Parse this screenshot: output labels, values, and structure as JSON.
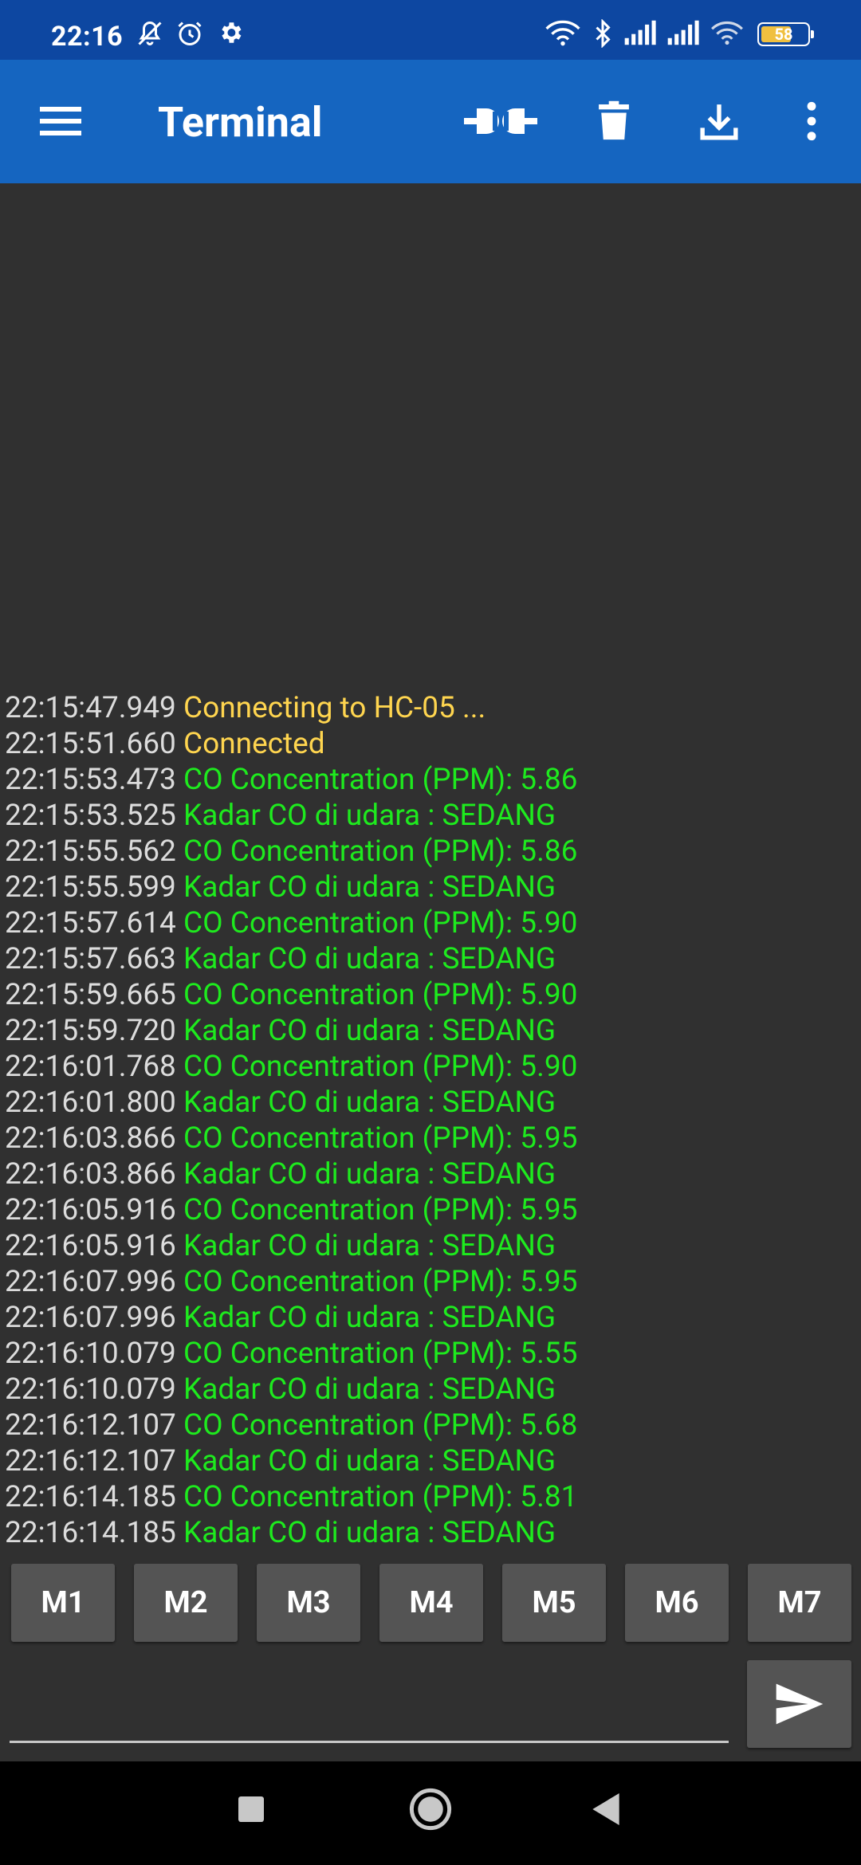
{
  "status_bar": {
    "time": "22:16",
    "icons": [
      "bell-off-icon",
      "alarm-icon",
      "gear-icon",
      "wifi-link-icon",
      "bluetooth-icon",
      "signal-icon",
      "signal-icon",
      "wifi-icon",
      "battery-icon"
    ],
    "battery_level": "58"
  },
  "app_bar": {
    "title": "Terminal",
    "actions": [
      "connect-icon",
      "delete-icon",
      "download-icon",
      "more-vert-icon"
    ]
  },
  "log": [
    {
      "time": "22:15:47.949",
      "text": "Connecting to HC-05 ...",
      "kind": "status"
    },
    {
      "time": "22:15:51.660",
      "text": "Connected",
      "kind": "status"
    },
    {
      "time": "22:15:53.473",
      "text": "CO Concentration (PPM): 5.86",
      "kind": "data"
    },
    {
      "time": "22:15:53.525",
      "text": "Kadar CO di udara : SEDANG",
      "kind": "data"
    },
    {
      "time": "22:15:55.562",
      "text": "CO Concentration (PPM): 5.86",
      "kind": "data"
    },
    {
      "time": "22:15:55.599",
      "text": "Kadar CO di udara : SEDANG",
      "kind": "data"
    },
    {
      "time": "22:15:57.614",
      "text": "CO Concentration (PPM): 5.90",
      "kind": "data"
    },
    {
      "time": "22:15:57.663",
      "text": "Kadar CO di udara : SEDANG",
      "kind": "data"
    },
    {
      "time": "22:15:59.665",
      "text": "CO Concentration (PPM): 5.90",
      "kind": "data"
    },
    {
      "time": "22:15:59.720",
      "text": "Kadar CO di udara : SEDANG",
      "kind": "data"
    },
    {
      "time": "22:16:01.768",
      "text": "CO Concentration (PPM): 5.90",
      "kind": "data"
    },
    {
      "time": "22:16:01.800",
      "text": "Kadar CO di udara : SEDANG",
      "kind": "data"
    },
    {
      "time": "22:16:03.866",
      "text": "CO Concentration (PPM): 5.95",
      "kind": "data"
    },
    {
      "time": "22:16:03.866",
      "text": "Kadar CO di udara : SEDANG",
      "kind": "data"
    },
    {
      "time": "22:16:05.916",
      "text": "CO Concentration (PPM): 5.95",
      "kind": "data"
    },
    {
      "time": "22:16:05.916",
      "text": "Kadar CO di udara : SEDANG",
      "kind": "data"
    },
    {
      "time": "22:16:07.996",
      "text": "CO Concentration (PPM): 5.95",
      "kind": "data"
    },
    {
      "time": "22:16:07.996",
      "text": "Kadar CO di udara : SEDANG",
      "kind": "data"
    },
    {
      "time": "22:16:10.079",
      "text": "CO Concentration (PPM): 5.55",
      "kind": "data"
    },
    {
      "time": "22:16:10.079",
      "text": "Kadar CO di udara : SEDANG",
      "kind": "data"
    },
    {
      "time": "22:16:12.107",
      "text": "CO Concentration (PPM): 5.68",
      "kind": "data"
    },
    {
      "time": "22:16:12.107",
      "text": "Kadar CO di udara : SEDANG",
      "kind": "data"
    },
    {
      "time": "22:16:14.185",
      "text": "CO Concentration (PPM): 5.81",
      "kind": "data"
    },
    {
      "time": "22:16:14.185",
      "text": "Kadar CO di udara : SEDANG",
      "kind": "data"
    }
  ],
  "macros": [
    "M1",
    "M2",
    "M3",
    "M4",
    "M5",
    "M6",
    "M7"
  ],
  "input": {
    "value": "",
    "placeholder": ""
  },
  "send": {
    "icon": "send-icon"
  },
  "nav_bar": {
    "icons": [
      "recents-square-icon",
      "home-circle-icon",
      "back-triangle-icon"
    ]
  },
  "colors": {
    "status_bar": "#0d47a1",
    "app_bar": "#1565c0",
    "background": "#303030",
    "timestamp": "#dcdcdc",
    "status_text": "#ffd54f",
    "data_text": "#1eea1e",
    "button": "#545454"
  }
}
